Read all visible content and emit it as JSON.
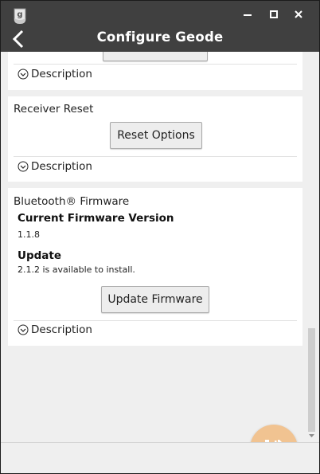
{
  "window": {
    "app_icon_letter": "g",
    "minimize_icon": "minimize-icon",
    "maximize_icon": "maximize-icon",
    "close_icon": "close-icon"
  },
  "header": {
    "title": "Configure Geode",
    "back_icon": "back-arrow-icon"
  },
  "cards": {
    "top": {
      "description_label": "Description"
    },
    "receiver_reset": {
      "title": "Receiver Reset",
      "button_label": "Reset Options",
      "description_label": "Description"
    },
    "bluetooth_firmware": {
      "title": "Bluetooth® Firmware",
      "current_label": "Current Firmware Version",
      "current_value": "1.1.8",
      "update_label": "Update",
      "update_text": "2.1.2 is available to install.",
      "button_label": "Update Firmware",
      "description_label": "Description"
    }
  },
  "fab": {
    "icon": "save-icon",
    "color": "#f1c391"
  },
  "colors": {
    "header_bg": "#404040",
    "content_bg": "#efefef",
    "card_bg": "#ffffff"
  }
}
